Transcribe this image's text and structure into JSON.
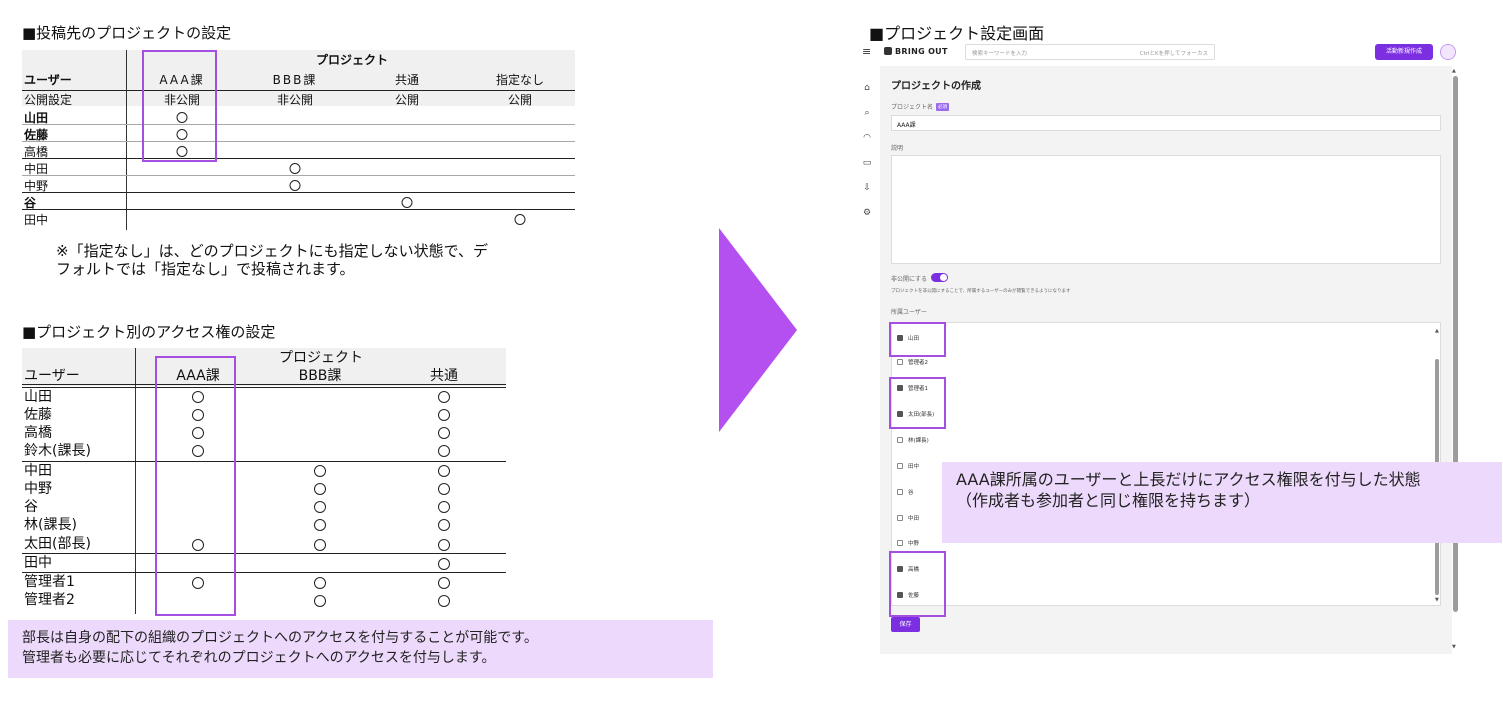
{
  "colors": {
    "highlight": "#a54fe0",
    "arrow": "#b44ff0",
    "callout_bg": "#ecd9fb",
    "accent": "#7b2fe0"
  },
  "section1": {
    "heading": "■投稿先のプロジェクトの設定",
    "group_header": "プロジェクト",
    "user_header": "ユーザー",
    "columns": [
      "AAA課",
      "BBB課",
      "共通",
      "指定なし"
    ],
    "visibility_label": "公開設定",
    "visibility": [
      "非公開",
      "非公開",
      "公開",
      "公開"
    ],
    "rows": [
      {
        "name": "山田",
        "marks": [
          true,
          false,
          false,
          false
        ]
      },
      {
        "name": "佐藤",
        "marks": [
          true,
          false,
          false,
          false
        ]
      },
      {
        "name": "高橋",
        "marks": [
          true,
          false,
          false,
          false
        ]
      },
      {
        "name": "中田",
        "marks": [
          false,
          true,
          false,
          false
        ]
      },
      {
        "name": "中野",
        "marks": [
          false,
          true,
          false,
          false
        ]
      },
      {
        "name": "谷",
        "marks": [
          false,
          false,
          true,
          false
        ]
      },
      {
        "name": "田中",
        "marks": [
          false,
          false,
          false,
          true
        ]
      }
    ],
    "note_line1": "※「指定なし」は、どのプロジェクトにも指定しない状態で、デ",
    "note_line2": "フォルトでは「指定なし」で投稿されます。"
  },
  "section2": {
    "heading": "■プロジェクト別のアクセス権の設定",
    "group_header": "プロジェクト",
    "user_header": "ユーザー",
    "columns": [
      "AAA課",
      "BBB課",
      "共通"
    ],
    "rows": [
      {
        "name": "山田",
        "marks": [
          true,
          false,
          true
        ]
      },
      {
        "name": "佐藤",
        "marks": [
          true,
          false,
          true
        ]
      },
      {
        "name": "高橋",
        "marks": [
          true,
          false,
          true
        ]
      },
      {
        "name": "鈴木(課長)",
        "marks": [
          true,
          false,
          true
        ]
      },
      {
        "name": "中田",
        "marks": [
          false,
          true,
          true
        ]
      },
      {
        "name": "中野",
        "marks": [
          false,
          true,
          true
        ]
      },
      {
        "name": "谷",
        "marks": [
          false,
          true,
          true
        ]
      },
      {
        "name": "林(課長)",
        "marks": [
          false,
          true,
          true
        ]
      },
      {
        "name": "太田(部長)",
        "marks": [
          true,
          true,
          true
        ]
      },
      {
        "name": "田中",
        "marks": [
          false,
          false,
          true
        ]
      },
      {
        "name": "管理者1",
        "marks": [
          true,
          true,
          true
        ]
      },
      {
        "name": "管理者2",
        "marks": [
          false,
          true,
          true
        ]
      }
    ],
    "callout_line1": "部長は自身の配下の組織のプロジェクトへのアクセスを付与することが可能です。",
    "callout_line2": "管理者も必要に応じてそれぞれのプロジェクトへのアクセスを付与します。"
  },
  "section3": {
    "heading": "■プロジェクト設定画面",
    "app": {
      "logo": "BRING OUT",
      "search_placeholder": "検索キーワードを入力",
      "search_hint": "CtrlとKを押してフォーカス",
      "create_button": "活動新規作成",
      "sidebar_icons": [
        "home-icon",
        "search-icon",
        "dashboard-icon",
        "video-icon",
        "download-icon",
        "settings-icon"
      ],
      "form_title": "プロジェクトの作成",
      "name_label": "プロジェクト名",
      "required_badge": "必須",
      "name_value": "AAA課",
      "description_label": "説明",
      "private_label": "非公開にする",
      "private_on": true,
      "private_help": "プロジェクトを非公開にすることで、所属するユーザーのみが閲覧できるようになります",
      "members_label": "所属ユーザー",
      "members": [
        {
          "name": "山田",
          "checked": true
        },
        {
          "name": "管理者2",
          "checked": false
        },
        {
          "name": "管理者1",
          "checked": true
        },
        {
          "name": "太田(部長)",
          "checked": true
        },
        {
          "name": "林(課長)",
          "checked": false
        },
        {
          "name": "田中",
          "checked": false
        },
        {
          "name": "谷",
          "checked": false
        },
        {
          "name": "中田",
          "checked": false
        },
        {
          "name": "中野",
          "checked": false
        },
        {
          "name": "高橋",
          "checked": true
        },
        {
          "name": "佐藤",
          "checked": true
        }
      ],
      "save_button": "保存"
    },
    "callout_line1": "AAA課所属のユーザーと上長だけにアクセス権限を付与した状態",
    "callout_line2": "（作成者も参加者と同じ権限を持ちます）"
  }
}
